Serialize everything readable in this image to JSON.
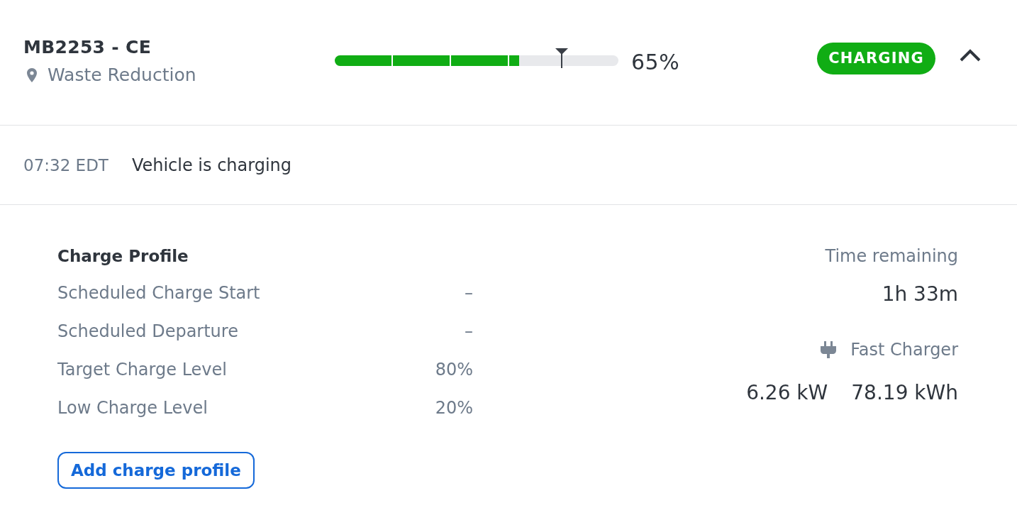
{
  "vehicle": {
    "name": "MB2253 - CE",
    "location": "Waste Reduction"
  },
  "battery": {
    "level": 0.65,
    "reading": "65%",
    "target": {
      "level": 0.8
    }
  },
  "status": {
    "label": "CHARGING"
  },
  "expanded": true,
  "event": {
    "time": "07:32 EDT",
    "message": "Vehicle is charging"
  },
  "charge_profile": {
    "title": "Charge Profile",
    "rows": [
      {
        "label": "Scheduled Charge Start",
        "value": "–"
      },
      {
        "label": "Scheduled Departure",
        "value": "–"
      },
      {
        "label": "Target Charge Level",
        "value": "80%"
      },
      {
        "label": "Low Charge Level",
        "value": "20%"
      }
    ],
    "button": "Add charge profile"
  },
  "charging": {
    "time_label": "Time remaining",
    "time_value": "1h 33m",
    "charger": "Fast Charger",
    "power": "6.26 kW",
    "energy": "78.19 kWh"
  }
}
